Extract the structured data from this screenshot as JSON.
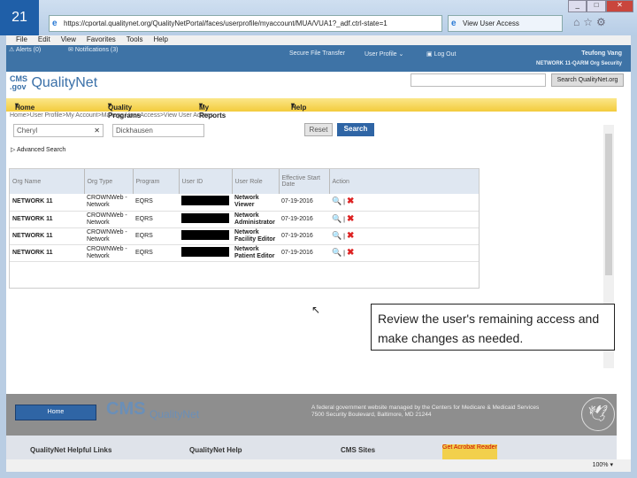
{
  "slide_number": "21",
  "browser": {
    "url": "https://cportal.qualitynet.org/QualityNetPortal/faces/userprofile/myaccount/MUA/VUA1?_adf.ctrl-state=1",
    "tab_title": "View User Access",
    "menu": [
      "File",
      "Edit",
      "View",
      "Favorites",
      "Tools",
      "Help"
    ],
    "zoom": "100%"
  },
  "header": {
    "alerts": "Alerts (0)",
    "notifications": "Notifications (3)",
    "secure_file_transfer": "Secure File Transfer",
    "user_profile": "User Profile",
    "log_out": "Log Out",
    "user_name": "Teufong Vang",
    "user_org": "NETWORK 11-QARM Org Security"
  },
  "logo": {
    "cms": "CMS",
    "gov": ".gov",
    "name": "QualityNet"
  },
  "search_site_button": "Search QualityNet.org",
  "nav": [
    "Home",
    "Quality Programs",
    "My Reports",
    "Help"
  ],
  "breadcrumb": "Home>User Profile>My Account>Manage User Access>View User Access",
  "search": {
    "first_name": "Cheryl",
    "last_name": "Dickhausen",
    "reset": "Reset",
    "search": "Search",
    "advanced": "Advanced Search"
  },
  "table": {
    "columns": [
      "Org Name",
      "Org Type",
      "Program",
      "User ID",
      "User Role",
      "Effective Start Date",
      "Action"
    ],
    "rows": [
      {
        "org": "NETWORK 11",
        "type": "CROWNWeb - Network",
        "program": "EQRS",
        "role": "Network Viewer",
        "date": "07-19-2016"
      },
      {
        "org": "NETWORK 11",
        "type": "CROWNWeb - Network",
        "program": "EQRS",
        "role": "Network Administrator",
        "date": "07-19-2016"
      },
      {
        "org": "NETWORK 11",
        "type": "CROWNWeb - Network",
        "program": "EQRS",
        "role": "Network Facility Editor",
        "date": "07-19-2016"
      },
      {
        "org": "NETWORK 11",
        "type": "CROWNWeb - Network",
        "program": "EQRS",
        "role": "Network Patient Editor",
        "date": "07-19-2016"
      }
    ]
  },
  "callout": "Review the user's remaining access and make changes as needed.",
  "footer": {
    "home": "Home",
    "text1": "A federal government website managed by the Centers for Medicare & Medicaid Services",
    "text2": "7500 Security Boulevard, Baltimore, MD 21244",
    "links": [
      "QualityNet Helpful Links",
      "QualityNet Help",
      "CMS Sites"
    ],
    "acrobat": "Get Acrobat Reader"
  }
}
